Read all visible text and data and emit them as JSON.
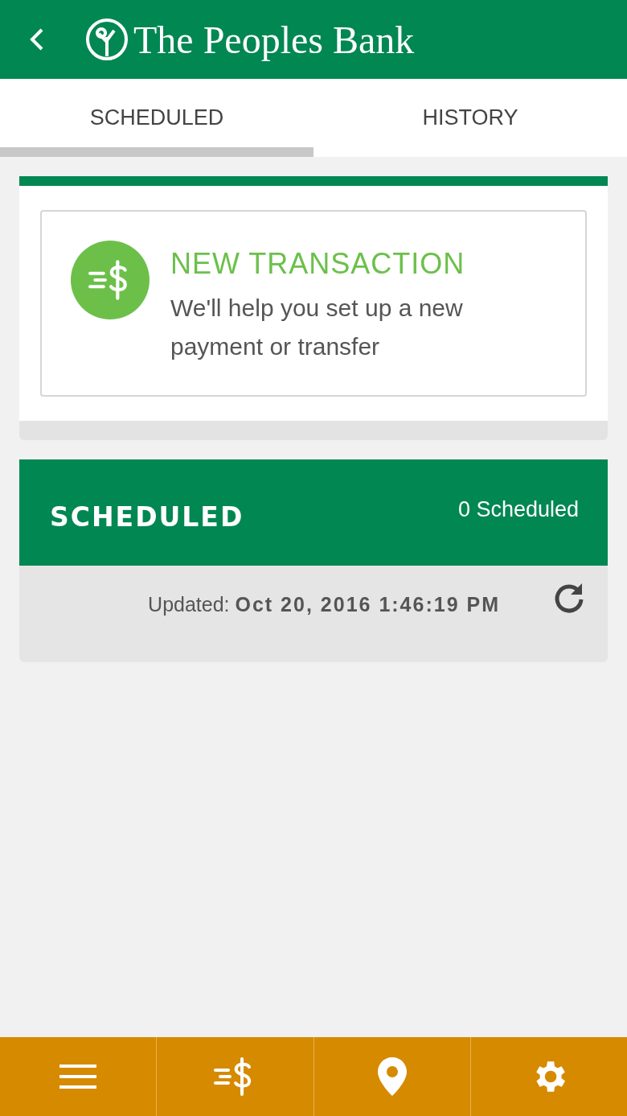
{
  "header": {
    "title": "The Peoples Bank"
  },
  "tabs": [
    {
      "label": "SCHEDULED",
      "selected": true
    },
    {
      "label": "HISTORY",
      "selected": false
    }
  ],
  "new_transaction": {
    "title": "NEW TRANSACTION",
    "description": "We'll help you set up a new payment or transfer"
  },
  "scheduled": {
    "title": "SCHEDULED",
    "count": "0 Scheduled",
    "updated": "Updated: **Oct 20, 2016 1:46:19 PM**"
  }
}
